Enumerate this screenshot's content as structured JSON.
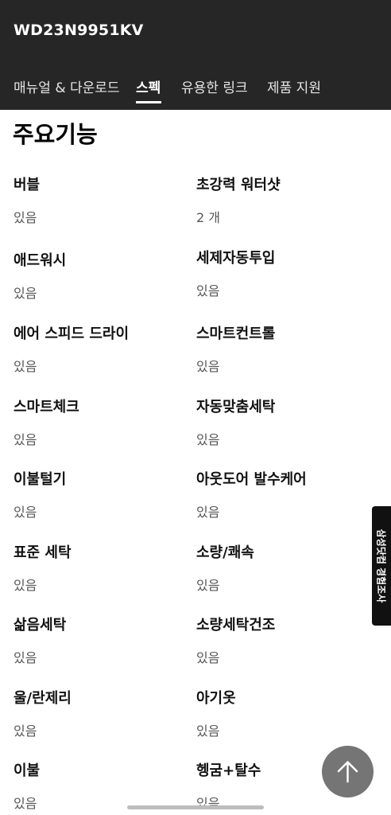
{
  "header": {
    "model": "WD23N9951KV",
    "tabs": [
      "매뉴얼 & 다운로드",
      "스펙",
      "유용한 링크",
      "제품 지원"
    ]
  },
  "section": {
    "title": "주요기능"
  },
  "specs": [
    {
      "label": "버블",
      "value": "있음"
    },
    {
      "label": "초강력 워터샷",
      "value": "2 개"
    },
    {
      "label": "애드워시",
      "value": "있음"
    },
    {
      "label": "세제자동투입",
      "value": "있음"
    },
    {
      "label": "에어 스피드 드라이",
      "value": "있음"
    },
    {
      "label": "스마트컨트롤",
      "value": "있음"
    },
    {
      "label": "스마트체크",
      "value": "있음"
    },
    {
      "label": "자동맞춤세탁",
      "value": "있음"
    },
    {
      "label": "이불털기",
      "value": "있음"
    },
    {
      "label": "아웃도어 발수케어",
      "value": "있음"
    },
    {
      "label": "표준 세탁",
      "value": "있음"
    },
    {
      "label": "소량/쾌속",
      "value": "있음"
    },
    {
      "label": "삶음세탁",
      "value": "있음"
    },
    {
      "label": "소량세탁건조",
      "value": "있음"
    },
    {
      "label": "울/란제리",
      "value": "있음"
    },
    {
      "label": "아기옷",
      "value": "있음"
    },
    {
      "label": "이불",
      "value": "있음"
    },
    {
      "label": "헹굼+탈수",
      "value": "있음"
    }
  ],
  "survey": {
    "label": "삼성닷컴 경험조사"
  },
  "icons": {
    "scroll_top": "arrow-up-icon"
  }
}
